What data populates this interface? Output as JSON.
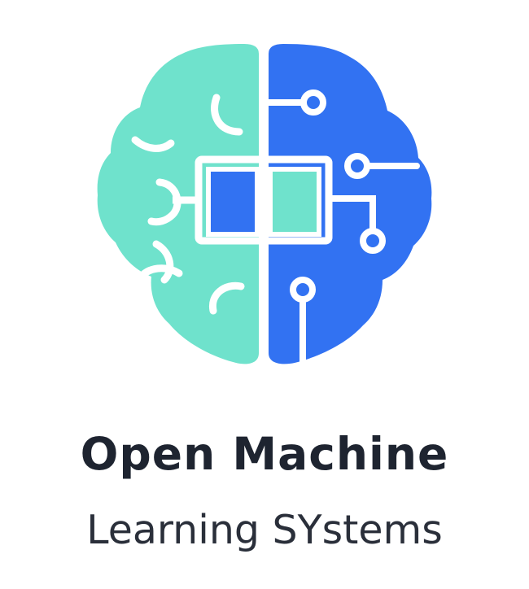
{
  "logo": {
    "icon": "brain-circuit-book-icon",
    "colors": {
      "left_hemisphere": "#6fe2cc",
      "right_hemisphere": "#3272f2",
      "text": "#1e2430"
    }
  },
  "title": {
    "line1": "Open Machine",
    "line2": "Learning SYstems"
  }
}
